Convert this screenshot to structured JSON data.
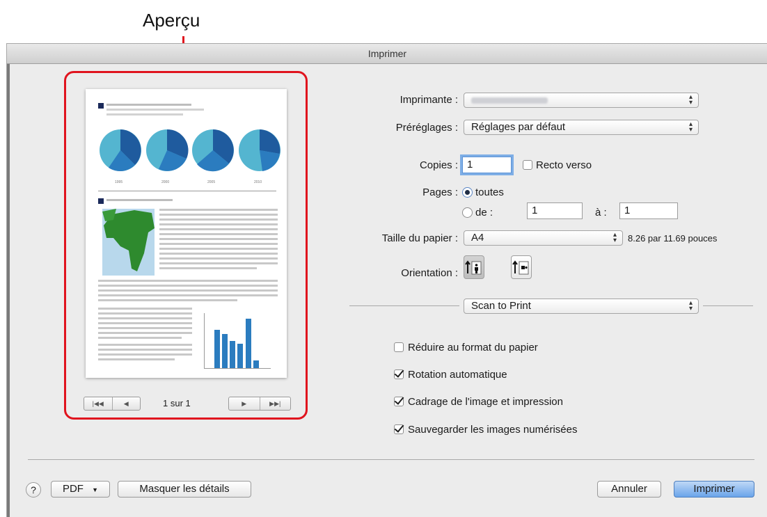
{
  "callout": {
    "label": "Aperçu"
  },
  "window": {
    "title": "Imprimer"
  },
  "preview": {
    "page_indicator": "1 sur 1",
    "nav_first": "|◀◀",
    "nav_prev": "◀",
    "nav_next": "▶",
    "nav_last": "▶▶|",
    "chart_year_labels": [
      "1995",
      "2000",
      "2005",
      "2010"
    ]
  },
  "form": {
    "printer_label": "Imprimante :",
    "presets_label": "Préréglages :",
    "presets_value": "Réglages par défaut",
    "copies_label": "Copies :",
    "copies_value": "1",
    "duplex_label": "Recto verso",
    "duplex_checked": false,
    "pages_label": "Pages :",
    "pages_all_label": "toutes",
    "pages_from_label": "de :",
    "pages_from_value": "1",
    "pages_to_label": "à :",
    "pages_to_value": "1",
    "paper_size_label": "Taille du papier :",
    "paper_size_value": "A4",
    "paper_size_dims": "8.26 par 11.69 pouces",
    "orientation_label": "Orientation :"
  },
  "section": {
    "selector_value": "Scan to Print",
    "options": [
      {
        "label": "Réduire au format du papier",
        "checked": false
      },
      {
        "label": "Rotation automatique",
        "checked": true
      },
      {
        "label": "Cadrage de l'image et impression",
        "checked": true
      },
      {
        "label": "Sauvegarder les images numérisées",
        "checked": true
      }
    ]
  },
  "footer": {
    "help": "?",
    "pdf_label": "PDF",
    "hide_details_label": "Masquer les détails",
    "cancel_label": "Annuler",
    "print_label": "Imprimer"
  },
  "colors": {
    "callout_red": "#e0141e",
    "accent_blue": "#6aa4ea",
    "chart_dark": "#1f5b9e",
    "chart_light": "#54b5d0"
  }
}
